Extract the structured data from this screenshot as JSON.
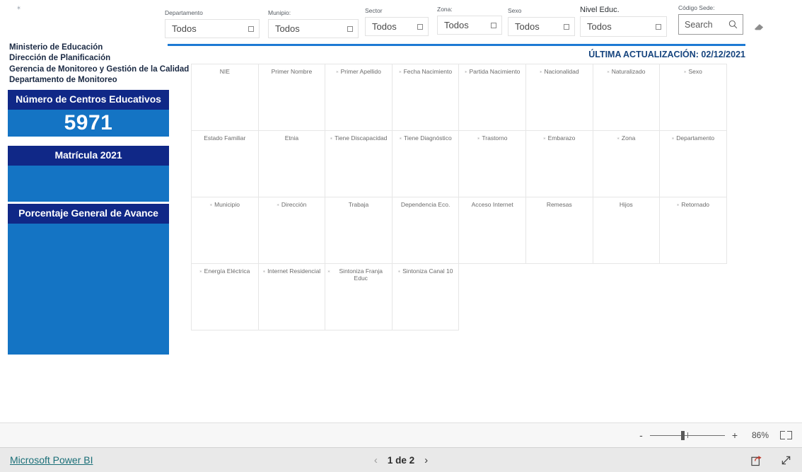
{
  "report": {
    "org_lines": [
      "Ministerio de Educación",
      "Dirección de Planificación",
      "Gerencia de Monitoreo y Gestión de la Calidad",
      "Departamento de Monitoreo"
    ],
    "last_update": "ÚLTIMA ACTUALIZACIÓN: 02/12/2021",
    "corner_mark": "⁎"
  },
  "kpis": [
    {
      "title": "Número de Centros Educativos",
      "value": "5971"
    },
    {
      "title": "Matrícula 2021",
      "value": ""
    },
    {
      "title": "Porcentaje General de Avance",
      "value": ""
    }
  ],
  "slicers": [
    {
      "label": "Departamento",
      "value": "Todos"
    },
    {
      "label": "Munipio:",
      "value": "Todos"
    },
    {
      "label": "Sector",
      "value": "Todos"
    },
    {
      "label": "Zona:",
      "value": "Todos"
    },
    {
      "label": "Sexo",
      "value": "Todos"
    },
    {
      "label": "Nivel Educ.",
      "value": "Todos"
    }
  ],
  "search": {
    "label": "Código Sede:",
    "placeholder": "Search",
    "value": "Search"
  },
  "fields": [
    {
      "name": "NIE",
      "required": false
    },
    {
      "name": "Primer Nombre",
      "required": false
    },
    {
      "name": "Primer Apellido",
      "required": true
    },
    {
      "name": "Fecha Nacimiento",
      "required": true
    },
    {
      "name": "Partida Nacimiento",
      "required": true
    },
    {
      "name": "Nacionalidad",
      "required": true
    },
    {
      "name": "Naturalizado",
      "required": true
    },
    {
      "name": "Sexo",
      "required": true
    },
    {
      "name": "Estado Familiar",
      "required": false
    },
    {
      "name": "Etnia",
      "required": false
    },
    {
      "name": "Tiene Discapacidad",
      "required": true
    },
    {
      "name": "Tiene Diagnóstico",
      "required": true
    },
    {
      "name": "Trastorno",
      "required": true
    },
    {
      "name": "Embarazo",
      "required": true
    },
    {
      "name": "Zona",
      "required": true
    },
    {
      "name": "Departamento",
      "required": true
    },
    {
      "name": "Municipio",
      "required": true
    },
    {
      "name": "Dirección",
      "required": true
    },
    {
      "name": "Trabaja",
      "required": false
    },
    {
      "name": "Dependencia Eco.",
      "required": false
    },
    {
      "name": "Acceso Internet",
      "required": false
    },
    {
      "name": "Remesas",
      "required": false
    },
    {
      "name": "Hijos",
      "required": false
    },
    {
      "name": "Retornado",
      "required": true
    },
    {
      "name": "Energía Eléctrica",
      "required": true
    },
    {
      "name": "Internet Residencial",
      "required": true
    },
    {
      "name": "Sintoniza Franja Educ",
      "required": true
    },
    {
      "name": "Sintoniza Canal 10",
      "required": true
    }
  ],
  "viewer": {
    "zoom_minus": "-",
    "zoom_plus": "+",
    "zoom_level": "86%",
    "brand": "Microsoft Power BI",
    "page_prev": "‹",
    "page_label": "1 de 2",
    "page_next": "›"
  },
  "colors": {
    "kpi_title_bg": "#102887",
    "kpi_body_bg": "#1474c4",
    "rule": "#1d7ad4",
    "accent_text": "#16447e",
    "brand_link": "#1a6f78"
  }
}
